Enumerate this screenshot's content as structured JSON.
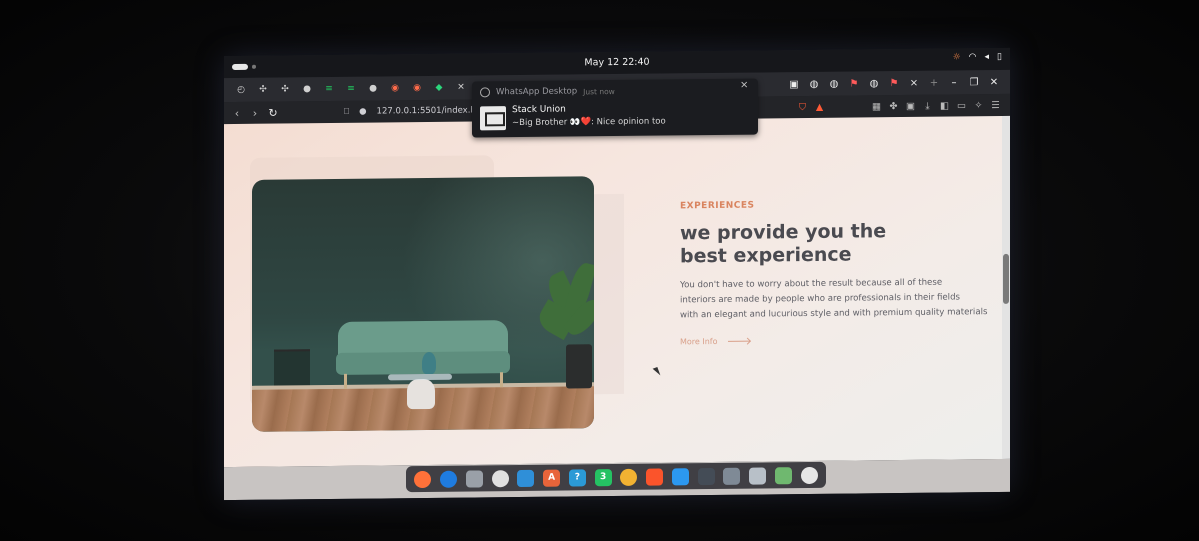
{
  "topbar": {
    "clock": "May 12  22:40"
  },
  "tabs": {
    "icons": [
      "history-icon",
      "extension-icon",
      "extension-icon",
      "github-icon",
      "terminal-icon",
      "terminal-icon",
      "github-icon",
      "target-icon",
      "target-icon",
      "diamond-icon",
      "tool-icon",
      "facebook-icon",
      "whatsapp-icon"
    ],
    "right_icons": [
      "screenshot-icon",
      "globe-icon",
      "globe-icon",
      "globe-icon",
      "flag-icon"
    ],
    "close_glyph": "×",
    "new_tab_glyph": "+"
  },
  "address": {
    "url": "127.0.0.1:5501/index.h"
  },
  "notification": {
    "app": "WhatsApp Desktop",
    "when": "Just now",
    "title": "Stack Union",
    "body_prefix": "~Big Brother ",
    "body_emoji": "👀❤️",
    "body_text": ": Nice opinion too"
  },
  "page": {
    "eyebrow": "EXPERIENCES",
    "heading_line1": "we provide you the",
    "heading_line2": "best experience",
    "desc_line1": "You don't have to worry about the result because all of these",
    "desc_line2": "interiors are made by people who are professionals in their fields",
    "desc_line3": "with an elegant and lucurious style and with premium quality materials",
    "more_label": "More Info"
  },
  "dock": {
    "apps": [
      {
        "name": "firefox-icon",
        "color": "#ff7139",
        "glyph": ""
      },
      {
        "name": "thunderbird-icon",
        "color": "#1f7ce0",
        "glyph": ""
      },
      {
        "name": "files-icon",
        "color": "#9aa0a8",
        "glyph": ""
      },
      {
        "name": "obs-icon",
        "color": "#e0e0e0",
        "glyph": ""
      },
      {
        "name": "editor-icon",
        "color": "#2f8fd8",
        "glyph": ""
      },
      {
        "name": "software-icon",
        "color": "#e8643a",
        "glyph": "A"
      },
      {
        "name": "help-icon",
        "color": "#2b9ad6",
        "glyph": "?"
      },
      {
        "name": "whatsapp-icon",
        "color": "#25c263",
        "glyph": "3"
      },
      {
        "name": "chrome-icon",
        "color": "#f2b232",
        "glyph": ""
      },
      {
        "name": "brave-icon",
        "color": "#fb542b",
        "glyph": ""
      },
      {
        "name": "vscode-icon",
        "color": "#2c98f0",
        "glyph": ""
      },
      {
        "name": "terminal-icon",
        "color": "#444c56",
        "glyph": ""
      },
      {
        "name": "search-icon",
        "color": "#7f8a96",
        "glyph": ""
      },
      {
        "name": "document-icon",
        "color": "#b8c0c8",
        "glyph": ""
      },
      {
        "name": "trash-icon",
        "color": "#6fb86f",
        "glyph": ""
      },
      {
        "name": "settings-icon",
        "color": "#e6e6e6",
        "glyph": ""
      }
    ]
  },
  "colors": {
    "accent": "#d9845f",
    "heading": "#4a4a50"
  }
}
